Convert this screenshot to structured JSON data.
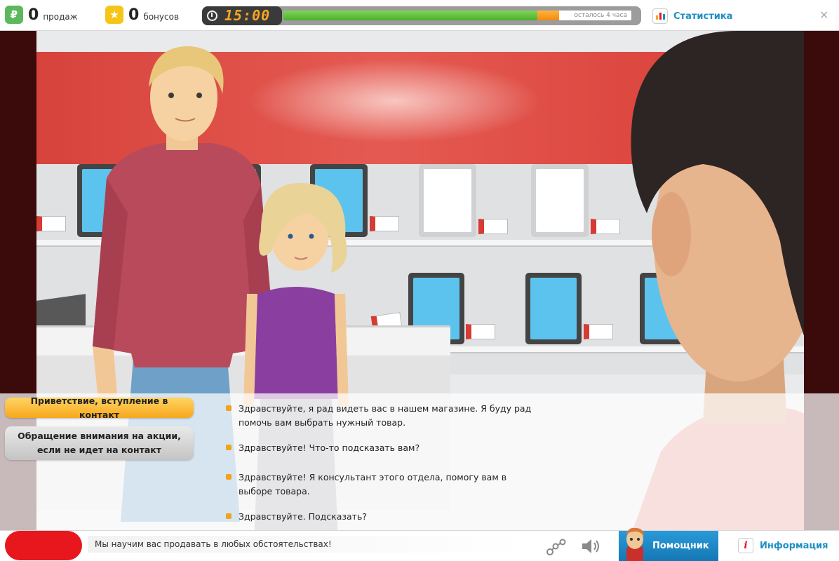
{
  "topbar": {
    "sales": {
      "icon": "ruble-icon",
      "icon_glyph": "₽",
      "icon_color": "#5cb85c",
      "count": "0",
      "label": "продаж"
    },
    "bonuses": {
      "icon": "star-icon",
      "icon_glyph": "★",
      "icon_color": "#f5c518",
      "count": "0",
      "label": "бонусов"
    },
    "timer": {
      "time": "15:00",
      "remaining_label": "осталось 4 часа",
      "progress_done": 0.73,
      "progress_current": 0.063
    },
    "stats_label": "Статистика",
    "close_glyph": "✕"
  },
  "dialogue": {
    "categories": [
      {
        "label": "Приветствие, вступление в контакт",
        "active": true
      },
      {
        "label": "Обращение внимания на акции, если не идет на контакт",
        "active": false
      }
    ],
    "options": [
      "Здравствуйте, я рад видеть вас в нашем магазине. Я буду рад помочь вам выбрать нужный товар.",
      "Здравствуйте! Что-то подсказать вам?",
      "Здравствуйте! Я консультант этого отдела, помогу вам в выборе товара.",
      "Здравствуйте. Подсказать?"
    ]
  },
  "bottombar": {
    "ticker": "Мы научим вас продавать в любых обстоятельствах!",
    "helper_label": "Помощник",
    "info_label": "Информация",
    "info_glyph": "i"
  },
  "colors": {
    "accent_blue": "#1d8fc4",
    "active_orange": "#f7a81c",
    "brand_red": "#e8161d",
    "progress_green": "#4caf2c"
  }
}
